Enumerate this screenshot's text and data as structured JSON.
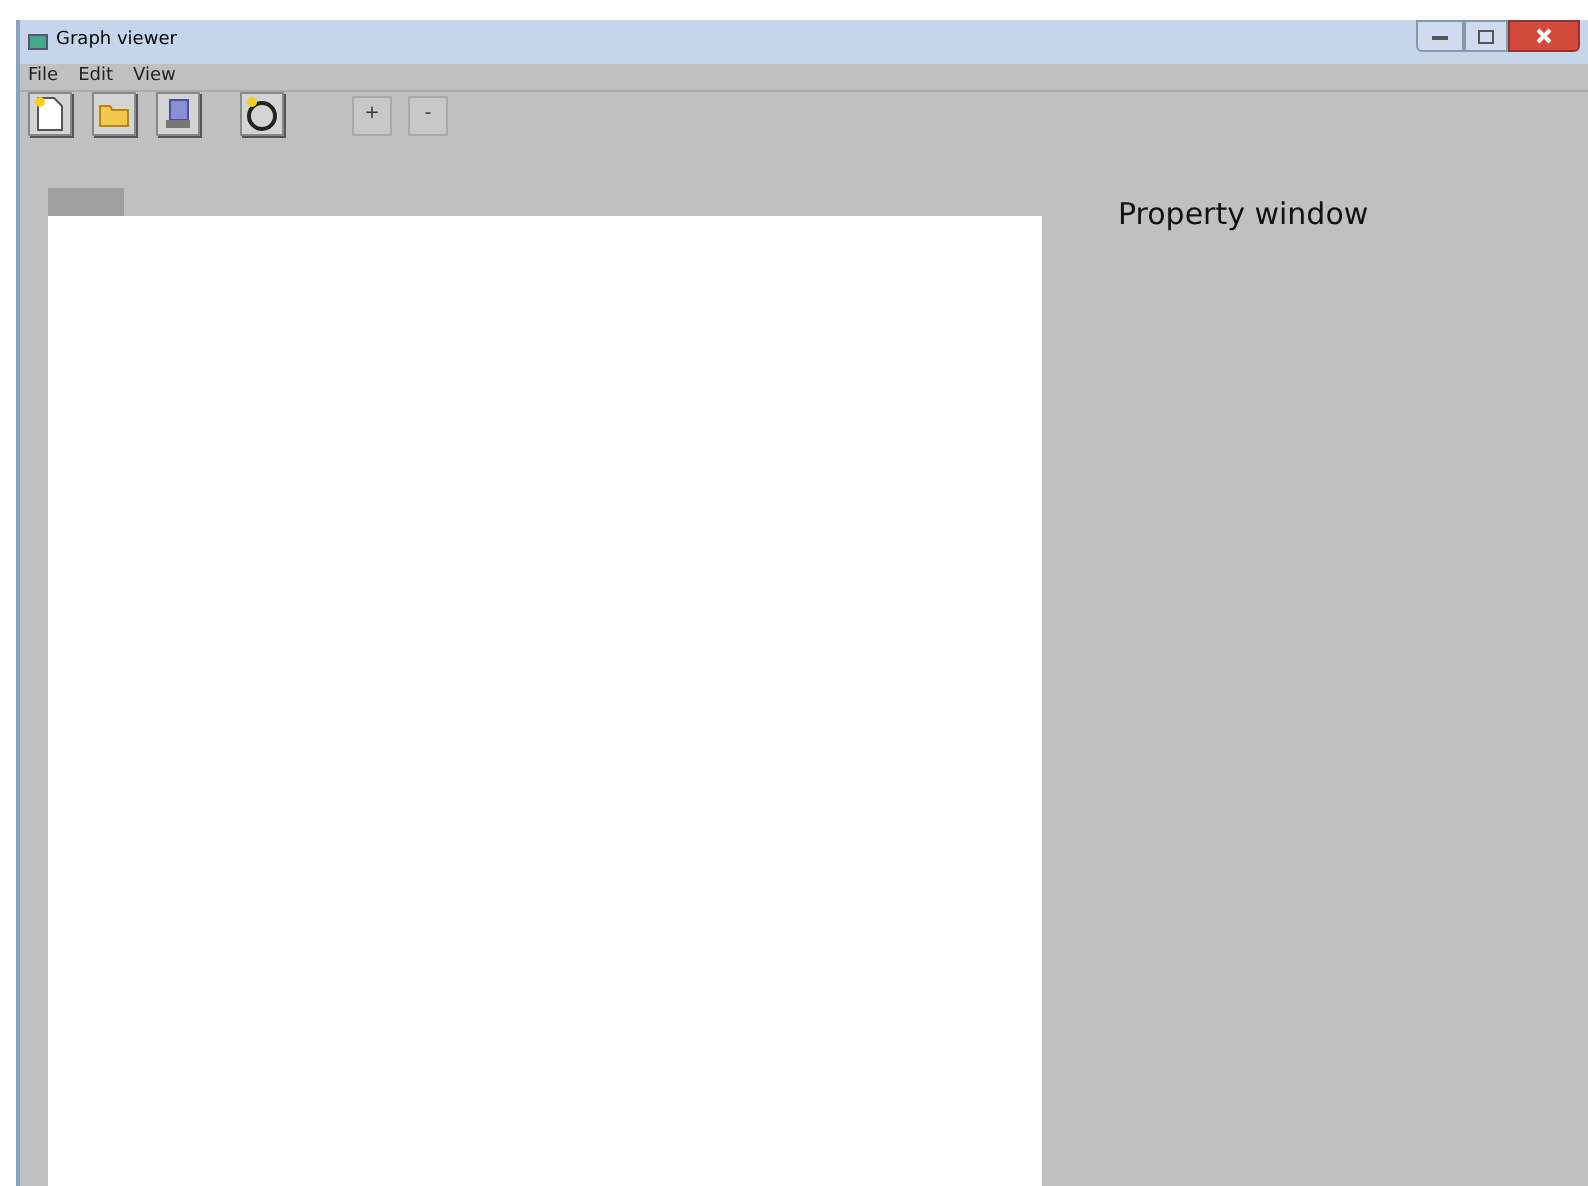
{
  "window": {
    "title": "Graph viewer"
  },
  "menu": [
    "File",
    "Edit",
    "View"
  ],
  "toolbar": {
    "zoom_buttons": [
      "+",
      "-"
    ]
  },
  "property_panel": {
    "title": "Property window"
  }
}
